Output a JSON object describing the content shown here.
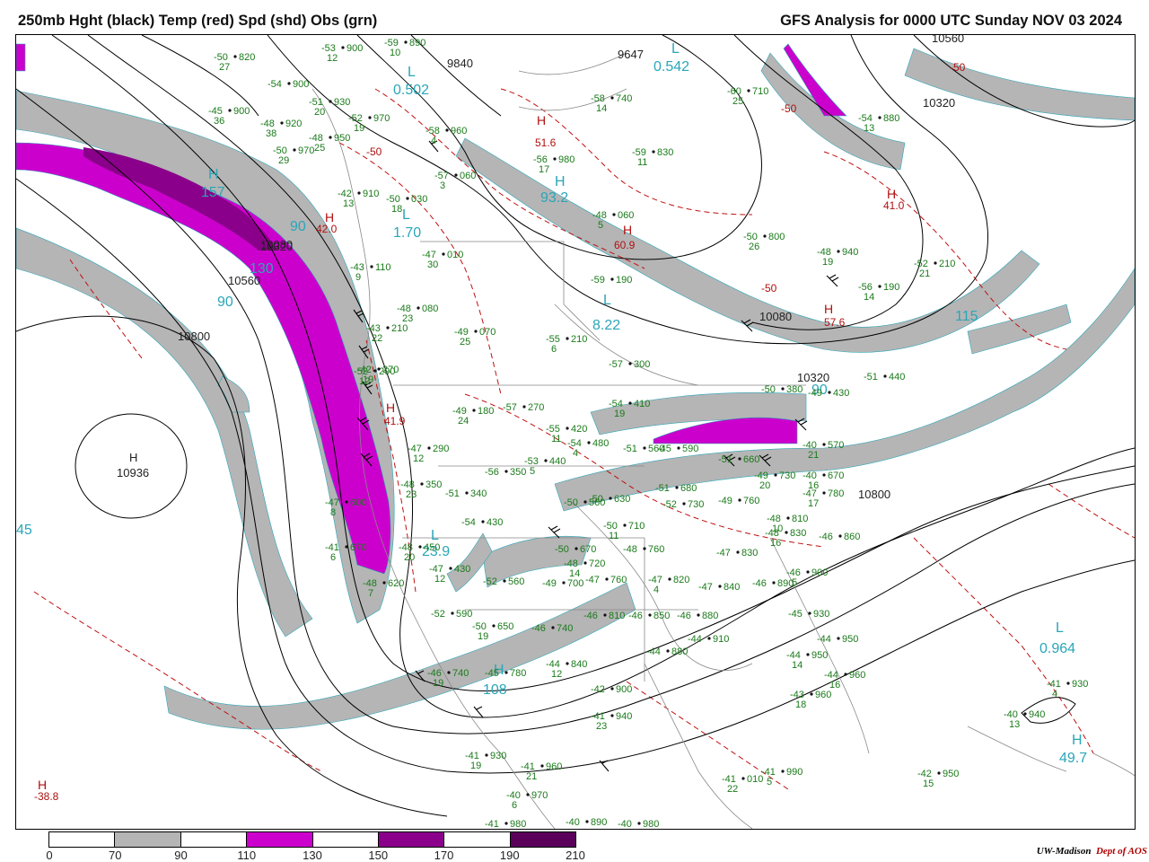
{
  "title_left": "250mb Hght (black) Temp (red) Spd (shd) Obs (grn)",
  "title_right": "GFS Analysis for 0000 UTC Sunday  NOV 03 2024",
  "legend": {
    "ticks": [
      "0",
      "70",
      "90",
      "110",
      "130",
      "150",
      "170",
      "190",
      "210"
    ],
    "colors": [
      "#ffffff",
      "#b5b5b5",
      "#ffffff",
      "#cc00cc",
      "#ffffff",
      "#8a008a",
      "#ffffff",
      "#5a005a"
    ]
  },
  "credit": {
    "uw": "UW-Madison",
    "dept": "Dept of AOS"
  },
  "colors": {
    "height": "#000000",
    "temp": "#c01010",
    "obs": "#1a7a1a",
    "speed_label": "#2aa6b8"
  },
  "height_labels": [
    "9840",
    "9647",
    "10320",
    "10560",
    "10080",
    "10800",
    "10320",
    "10800",
    "10560",
    "10080",
    "10320"
  ],
  "high_center": {
    "marker": "H",
    "value": "10936"
  },
  "speed_centers": [
    {
      "marker": "L",
      "value": "0.502"
    },
    {
      "marker": "L",
      "value": "0.542"
    },
    {
      "marker": "L",
      "value": "1.70"
    },
    {
      "marker": "L",
      "value": "8.22"
    },
    {
      "marker": "L",
      "value": "23.9"
    },
    {
      "marker": "L",
      "value": "0.964"
    },
    {
      "marker": "H",
      "value": "108"
    },
    {
      "marker": "H",
      "value": "157"
    },
    {
      "marker": "H",
      "value": "93.2"
    },
    {
      "marker": "H",
      "value": "49.7"
    }
  ],
  "speed_contour_labels": [
    "90",
    "130",
    "90",
    "115",
    "45",
    "90"
  ],
  "temp_centers": [
    {
      "marker": "H",
      "value": "51.6"
    },
    {
      "marker": "H",
      "value": "41.0"
    },
    {
      "marker": "H",
      "value": "60.9"
    },
    {
      "marker": "H",
      "value": "42.0"
    },
    {
      "marker": "H",
      "value": "41.9"
    },
    {
      "marker": "H",
      "value": "57.6"
    },
    {
      "marker": "H",
      "value": "-38.8"
    }
  ],
  "temp_contour_labels": [
    "-50",
    "-50",
    "-50",
    "-50"
  ],
  "observations": [
    {
      "t": "-50",
      "h": "820",
      "w": "27"
    },
    {
      "t": "-59",
      "h": "890",
      "w": "10"
    },
    {
      "t": "-53",
      "h": "900",
      "w": "12"
    },
    {
      "t": "-54",
      "h": "900",
      "w": ""
    },
    {
      "t": "-45",
      "h": "900",
      "w": "36"
    },
    {
      "t": "-51",
      "h": "930",
      "w": "20"
    },
    {
      "t": "-48",
      "h": "920",
      "w": "38"
    },
    {
      "t": "-52",
      "h": "970",
      "w": "19"
    },
    {
      "t": "-48",
      "h": "950",
      "w": "25"
    },
    {
      "t": "-50",
      "h": "970",
      "w": "29"
    },
    {
      "t": "-58",
      "h": "960",
      "w": "4"
    },
    {
      "t": "-58",
      "h": "740",
      "w": "14"
    },
    {
      "t": "-60",
      "h": "710",
      "w": "25"
    },
    {
      "t": "-54",
      "h": "880",
      "w": "13"
    },
    {
      "t": "-57",
      "h": "060",
      "w": "3"
    },
    {
      "t": "-56",
      "h": "980",
      "w": "17"
    },
    {
      "t": "-59",
      "h": "830",
      "w": "11"
    },
    {
      "t": "-42",
      "h": "910",
      "w": "13"
    },
    {
      "t": "-50",
      "h": "030",
      "w": "18"
    },
    {
      "t": "-48",
      "h": "060",
      "w": "5"
    },
    {
      "t": "-47",
      "h": "010",
      "w": "30"
    },
    {
      "t": "-50",
      "h": "800",
      "w": "26"
    },
    {
      "t": "-48",
      "h": "940",
      "w": "19"
    },
    {
      "t": "-43",
      "h": "110",
      "w": "9"
    },
    {
      "t": "-59",
      "h": "190",
      "w": ""
    },
    {
      "t": "-52",
      "h": "210",
      "w": "21"
    },
    {
      "t": "-56",
      "h": "190",
      "w": "14"
    },
    {
      "t": "-48",
      "h": "080",
      "w": "23"
    },
    {
      "t": "-49",
      "h": "070",
      "w": "25"
    },
    {
      "t": "-43",
      "h": "210",
      "w": "22"
    },
    {
      "t": "-55",
      "h": "210",
      "w": "6"
    },
    {
      "t": "-52",
      "h": "290",
      "w": "12"
    },
    {
      "t": "-57",
      "h": "300",
      "w": ""
    },
    {
      "t": "-42",
      "h": "270",
      "w": "19"
    },
    {
      "t": "-51",
      "h": "440",
      "w": ""
    },
    {
      "t": "-49",
      "h": "180",
      "w": "24"
    },
    {
      "t": "-57",
      "h": "270",
      "w": ""
    },
    {
      "t": "-54",
      "h": "410",
      "w": "19"
    },
    {
      "t": "-50",
      "h": "380",
      "w": ""
    },
    {
      "t": "-49",
      "h": "430",
      "w": ""
    },
    {
      "t": "-55",
      "h": "420",
      "w": "11"
    },
    {
      "t": "-54",
      "h": "480",
      "w": "4"
    },
    {
      "t": "-51",
      "h": "560",
      "w": ""
    },
    {
      "t": "-45",
      "h": "590",
      "w": ""
    },
    {
      "t": "-40",
      "h": "570",
      "w": "21"
    },
    {
      "t": "-47",
      "h": "290",
      "w": "12"
    },
    {
      "t": "-53",
      "h": "440",
      "w": "5"
    },
    {
      "t": "-56",
      "h": "350",
      "w": ""
    },
    {
      "t": "-51",
      "h": "660",
      "w": ""
    },
    {
      "t": "-40",
      "h": "670",
      "w": "16"
    },
    {
      "t": "-48",
      "h": "350",
      "w": "23"
    },
    {
      "t": "-51",
      "h": "340",
      "w": ""
    },
    {
      "t": "-49",
      "h": "730",
      "w": "20"
    },
    {
      "t": "-47",
      "h": "780",
      "w": "17"
    },
    {
      "t": "-47",
      "h": "600",
      "w": "8"
    },
    {
      "t": "-50",
      "h": "560",
      "w": ""
    },
    {
      "t": "-50",
      "h": "630",
      "w": ""
    },
    {
      "t": "-51",
      "h": "680",
      "w": ""
    },
    {
      "t": "-52",
      "h": "730",
      "w": ""
    },
    {
      "t": "-49",
      "h": "760",
      "w": ""
    },
    {
      "t": "-54",
      "h": "430",
      "w": ""
    },
    {
      "t": "-50",
      "h": "710",
      "w": "11"
    },
    {
      "t": "-48",
      "h": "810",
      "w": "10"
    },
    {
      "t": "-48",
      "h": "830",
      "w": "16"
    },
    {
      "t": "-46",
      "h": "860",
      "w": ""
    },
    {
      "t": "-41",
      "h": "670",
      "w": "6"
    },
    {
      "t": "-48",
      "h": "450",
      "w": "20"
    },
    {
      "t": "-50",
      "h": "670",
      "w": ""
    },
    {
      "t": "-48",
      "h": "760",
      "w": ""
    },
    {
      "t": "-47",
      "h": "830",
      "w": ""
    },
    {
      "t": "-46",
      "h": "900",
      "w": "5"
    },
    {
      "t": "-47",
      "h": "430",
      "w": "12"
    },
    {
      "t": "-48",
      "h": "720",
      "w": "14"
    },
    {
      "t": "-47",
      "h": "820",
      "w": "4"
    },
    {
      "t": "-46",
      "h": "890",
      "w": ""
    },
    {
      "t": "-48",
      "h": "620",
      "w": "7"
    },
    {
      "t": "-52",
      "h": "560",
      "w": ""
    },
    {
      "t": "-49",
      "h": "700",
      "w": ""
    },
    {
      "t": "-47",
      "h": "760",
      "w": ""
    },
    {
      "t": "-47",
      "h": "840",
      "w": ""
    },
    {
      "t": "-45",
      "h": "930",
      "w": ""
    },
    {
      "t": "-52",
      "h": "590",
      "w": ""
    },
    {
      "t": "-50",
      "h": "650",
      "w": "19"
    },
    {
      "t": "-46",
      "h": "740",
      "w": ""
    },
    {
      "t": "-46",
      "h": "810",
      "w": ""
    },
    {
      "t": "-46",
      "h": "850",
      "w": ""
    },
    {
      "t": "-46",
      "h": "880",
      "w": ""
    },
    {
      "t": "-44",
      "h": "950",
      "w": ""
    },
    {
      "t": "-44",
      "h": "880",
      "w": ""
    },
    {
      "t": "-44",
      "h": "910",
      "w": ""
    },
    {
      "t": "-44",
      "h": "950",
      "w": "14"
    },
    {
      "t": "-46",
      "h": "740",
      "w": "19"
    },
    {
      "t": "-45",
      "h": "780",
      "w": ""
    },
    {
      "t": "-44",
      "h": "840",
      "w": "12"
    },
    {
      "t": "-42",
      "h": "900",
      "w": ""
    },
    {
      "t": "-44",
      "h": "960",
      "w": "16"
    },
    {
      "t": "-43",
      "h": "960",
      "w": "18"
    },
    {
      "t": "-41",
      "h": "940",
      "w": "23"
    },
    {
      "t": "-41",
      "h": "930",
      "w": "19"
    },
    {
      "t": "-41",
      "h": "960",
      "w": "21"
    },
    {
      "t": "-40",
      "h": "970",
      "w": "6"
    },
    {
      "t": "-41",
      "h": "010",
      "w": "22"
    },
    {
      "t": "-41",
      "h": "990",
      "w": "5"
    },
    {
      "t": "-42",
      "h": "950",
      "w": "15"
    },
    {
      "t": "-40",
      "h": "940",
      "w": "13"
    },
    {
      "t": "-41",
      "h": "930",
      "w": "4"
    },
    {
      "t": "-41",
      "h": "980",
      "w": ""
    },
    {
      "t": "-40",
      "h": "890",
      "w": ""
    },
    {
      "t": "-40",
      "h": "980",
      "w": ""
    }
  ]
}
